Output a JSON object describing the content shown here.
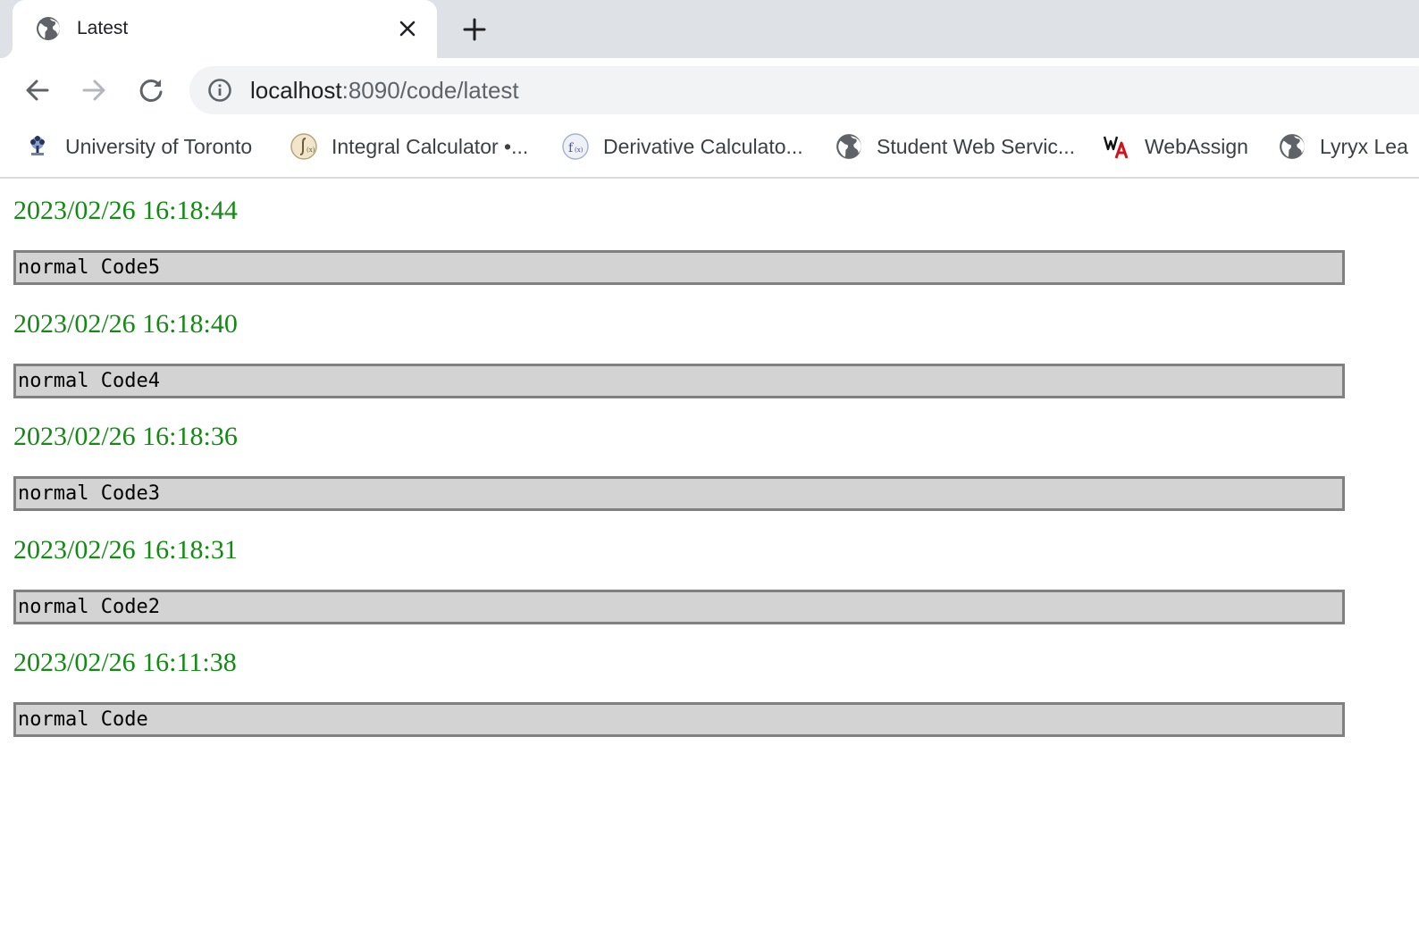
{
  "browser": {
    "tab": {
      "title": "Latest",
      "favicon": "globe-icon",
      "close_icon": "close-icon"
    },
    "new_tab_icon": "plus-icon",
    "nav": {
      "back_icon": "arrow-left-icon",
      "forward_icon": "arrow-right-icon",
      "reload_icon": "reload-icon"
    },
    "omnibox": {
      "info_icon": "info-icon",
      "url_host": "localhost",
      "url_rest": ":8090/code/latest"
    },
    "bookmarks": [
      {
        "label": "University of Toronto",
        "icon": "uoft-crest-icon"
      },
      {
        "label": "Integral Calculator •...",
        "icon": "integral-calculator-icon"
      },
      {
        "label": "Derivative Calculato...",
        "icon": "derivative-calculator-icon"
      },
      {
        "label": "Student Web Servic...",
        "icon": "globe-icon"
      },
      {
        "label": "WebAssign",
        "icon": "webassign-icon"
      },
      {
        "label": "Lyryx Lea",
        "icon": "globe-icon"
      }
    ]
  },
  "entries": [
    {
      "time": "2023/02/26 16:18:44",
      "code": "normal Code5"
    },
    {
      "time": "2023/02/26 16:18:40",
      "code": "normal Code4"
    },
    {
      "time": "2023/02/26 16:18:36",
      "code": "normal Code3"
    },
    {
      "time": "2023/02/26 16:18:31",
      "code": "normal Code2"
    },
    {
      "time": "2023/02/26 16:11:38",
      "code": "normal Code"
    }
  ],
  "colors": {
    "timestamp": "#138a13",
    "code_bg": "#d3d3d3",
    "code_border": "#808080"
  }
}
